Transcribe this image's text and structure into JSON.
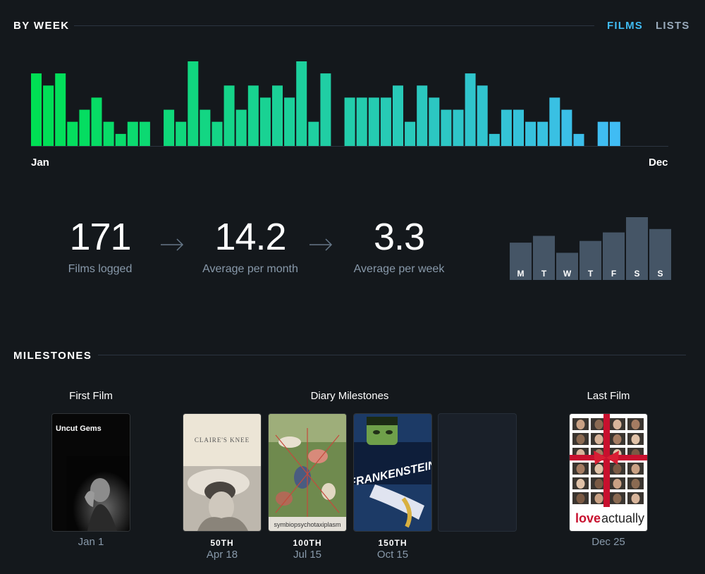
{
  "by_week": {
    "title": "BY WEEK",
    "tabs": [
      {
        "label": "FILMS",
        "active": true
      },
      {
        "label": "LISTS",
        "active": false
      }
    ],
    "start_label": "Jan",
    "end_label": "Dec"
  },
  "chart_data": [
    {
      "type": "bar",
      "name": "weekly",
      "values": [
        6,
        5,
        6,
        2,
        3,
        4,
        2,
        1,
        2,
        2,
        0,
        3,
        2,
        7,
        3,
        2,
        5,
        3,
        5,
        4,
        5,
        4,
        7,
        2,
        6,
        0,
        4,
        4,
        4,
        4,
        5,
        2,
        5,
        4,
        3,
        3,
        6,
        5,
        1,
        3,
        3,
        2,
        2,
        4,
        3,
        1,
        0,
        2,
        2
      ],
      "ylim": [
        0,
        7
      ],
      "grid": false,
      "start_color": "#00e054",
      "end_color": "#40bcf4"
    },
    {
      "type": "bar",
      "name": "by_day",
      "categories": [
        "M",
        "T",
        "W",
        "T",
        "F",
        "S",
        "S"
      ],
      "values": [
        22,
        26,
        16,
        23,
        28,
        37,
        30
      ],
      "ylim": [
        0,
        37
      ],
      "color": "#455566"
    }
  ],
  "stats": [
    {
      "value": "171",
      "label": "Films logged"
    },
    {
      "value": "14.2",
      "label": "Average per month"
    },
    {
      "value": "3.3",
      "label": "Average per week"
    }
  ],
  "milestones": {
    "title": "MILESTONES",
    "first_film": {
      "heading": "First Film",
      "poster_title": "Uncut Gems",
      "date": "Jan 1"
    },
    "diary_heading": "Diary Milestones",
    "diary": [
      {
        "rank": "50TH",
        "date": "Apr 18",
        "poster_title": "CLAIRE'S KNEE"
      },
      {
        "rank": "100TH",
        "date": "Jul 15",
        "poster_title": "symbiopsychotaxiplasm"
      },
      {
        "rank": "150TH",
        "date": "Oct 15",
        "poster_title": "FRANKENSTEIN"
      }
    ],
    "last_film": {
      "heading": "Last Film",
      "poster_title_a": "love",
      "poster_title_b": "actually",
      "date": "Dec 25"
    }
  },
  "colors": {
    "background": "#14181c",
    "muted_text": "#8899aa",
    "tab_active": "#40bcf4",
    "tab_inactive": "#99aabb"
  }
}
